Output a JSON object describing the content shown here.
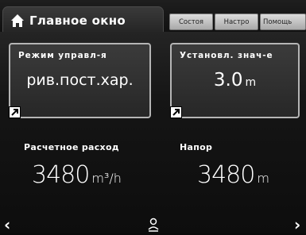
{
  "tabs": {
    "active": {
      "label": "Главное окно",
      "icon": "home-icon"
    },
    "state": "Состоя",
    "settings": "Настро",
    "help": "Помощь"
  },
  "cards": {
    "control_mode": {
      "title": "Режим управл-я",
      "value": "рив.пост.хар.",
      "icon": "link-icon"
    },
    "setpoint": {
      "title": "Установл. знач-е",
      "value": "3.0",
      "unit": "m",
      "icon": "link-icon"
    }
  },
  "readings": {
    "flow": {
      "label": "Расчетное расход",
      "value": "3480",
      "unit": "m³/h"
    },
    "head": {
      "label": "Напор",
      "value": "3480",
      "unit": "m"
    }
  },
  "nav": {
    "prev": "‹",
    "next": "›",
    "user_icon": "user-icon"
  },
  "colors": {
    "background": "#0a0a0a",
    "card_border": "#b5b5b5",
    "inactive_tab": "#c8c8c8",
    "text": "#ffffff"
  }
}
